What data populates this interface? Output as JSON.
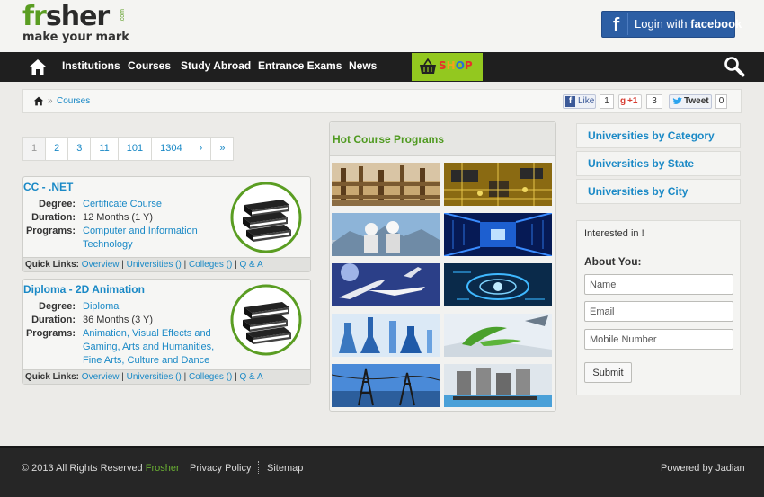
{
  "header": {
    "logo_text_green": "fr",
    "logo_text_rest": "sher",
    "logo_dotcom": ".com",
    "logo_tagline": "make your mark",
    "fb_login_prefix": "Login with",
    "fb_login_brand": "facebook"
  },
  "nav": {
    "items": [
      "Institutions",
      "Courses",
      "Study Abroad",
      "Entrance Exams",
      "News"
    ],
    "shop_letters": [
      "S",
      "H",
      "O",
      "P"
    ],
    "shop_colors": [
      "#e8302a",
      "#f2a31b",
      "#2a6ed8",
      "#e8302a"
    ]
  },
  "breadcrumb": {
    "current": "Courses",
    "separator": "»"
  },
  "social": {
    "like_label": "Like",
    "like_count": "1",
    "gplus_label": "+1",
    "gplus_count": "3",
    "tweet_label": "Tweet",
    "tweet_count": "0"
  },
  "pagination": [
    "1",
    "2",
    "3",
    "11",
    "101",
    "1304",
    "›",
    "»"
  ],
  "courses": [
    {
      "title": "CC - .NET",
      "degree_label": "Degree:",
      "degree": "Certificate Course",
      "duration_label": "Duration:",
      "duration": "12 Months (1 Y)",
      "programs_label": "Programs:",
      "programs": "Computer and Information Technology"
    },
    {
      "title": "Diploma - 2D Animation",
      "degree_label": "Degree:",
      "degree": "Diploma",
      "duration_label": "Duration:",
      "duration": "36 Months (3 Y)",
      "programs_label": "Programs:",
      "programs": "Animation, Visual Effects and Gaming, Arts and Humanities, Fine Arts, Culture and Dance"
    }
  ],
  "quick_links": {
    "label": "Quick Links:",
    "overview": "Overview",
    "universities": "Universities ()",
    "colleges": "Colleges ()",
    "qa": "Q & A",
    "sep": "|"
  },
  "hot": {
    "title": "Hot Course Programs"
  },
  "right": {
    "links": [
      "Universities by Category",
      "Universities by State",
      "Universities by City"
    ],
    "interested": "Interested in !",
    "about": "About You:",
    "name_ph": "Name",
    "email_ph": "Email",
    "mobile_ph": "Mobile Number",
    "submit": "Submit"
  },
  "footer": {
    "copyright": "© 2013 All Rights Reserved",
    "brand": "Frosher",
    "privacy": "Privacy Policy",
    "sitemap": "Sitemap",
    "powered": "Powered by Jadian"
  },
  "colors": {
    "accent_green": "#5a9d22",
    "link_blue": "#1a89c6",
    "nav_bg": "#1f1f1f",
    "facebook": "#2c5ea4"
  }
}
